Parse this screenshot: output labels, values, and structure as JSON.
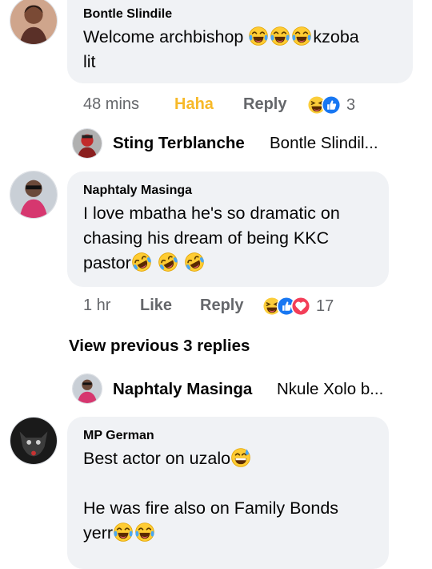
{
  "comments": [
    {
      "author": "Bontle Slindile",
      "lines": [
        "Welcome archbishop",
        "lit"
      ],
      "trailing_text": "kzoba",
      "time": "48 mins",
      "reaction_label": "Haha",
      "reply_label": "Reply",
      "reaction_count": "3",
      "reply_preview": {
        "name": "Sting Terblanche",
        "snippet": "Bontle Slindil..."
      }
    },
    {
      "author": "Naphtaly Masinga",
      "lines": [
        "I love mbatha he's so dramatic on",
        "chasing his dream of being KKC",
        "pastor"
      ],
      "time": "1 hr",
      "reaction_label": "Like",
      "reply_label": "Reply",
      "reaction_count": "17",
      "view_previous": "View previous 3 replies",
      "reply_preview": {
        "name": "Naphtaly Masinga",
        "snippet": "Nkule Xolo b..."
      }
    },
    {
      "author": "MP German",
      "lines": [
        "Best actor on uzalo",
        "",
        "He was fire also on Family Bonds",
        "yerr"
      ]
    }
  ],
  "icons": {
    "laugh_emoji": "tears-of-joy-emoji",
    "rofl_emoji": "rolling-on-floor-laughing-emoji",
    "sweat_smile_emoji": "grinning-sweat-emoji",
    "haha_reaction": "haha-reaction-icon",
    "like_reaction": "like-reaction-icon",
    "love_reaction": "love-reaction-icon"
  },
  "colors": {
    "haha_active": "#f7b928",
    "meta": "#65676b",
    "bubble": "#f0f2f5",
    "like_blue": "#1877f2",
    "love_red": "#f33e58"
  }
}
